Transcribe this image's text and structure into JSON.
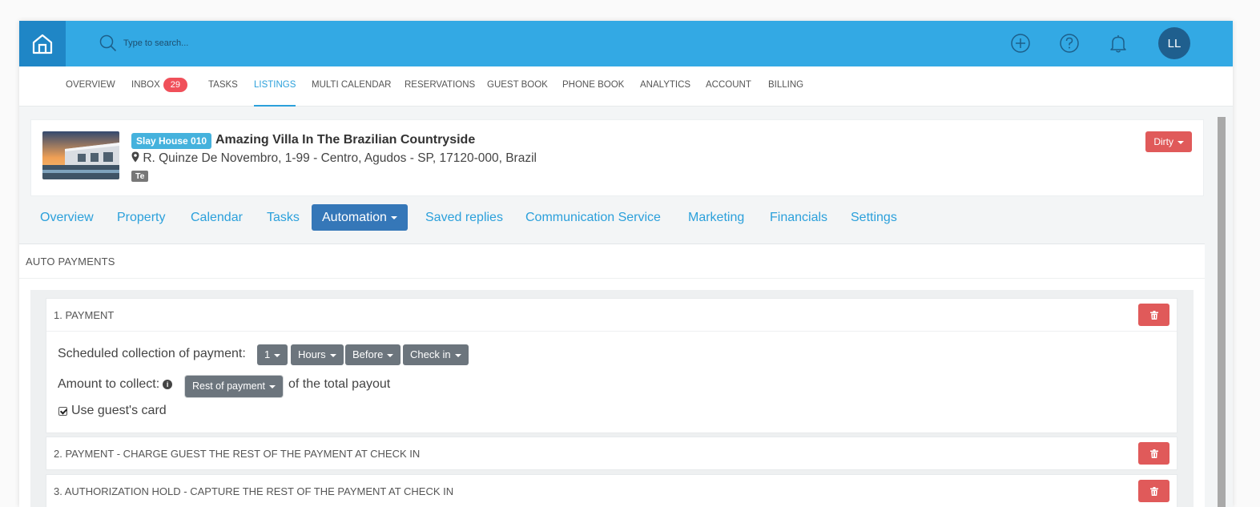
{
  "header": {
    "search_placeholder": "Type to search...",
    "avatar_initials": "LL",
    "icons": [
      "home-icon",
      "search-icon",
      "plus-circle-icon",
      "help-icon",
      "bell-icon"
    ]
  },
  "mainnav": {
    "items": [
      {
        "label": "OVERVIEW"
      },
      {
        "label": "INBOX",
        "badge": "29"
      },
      {
        "label": "TASKS"
      },
      {
        "label": "LISTINGS",
        "active": true
      },
      {
        "label": "MULTI CALENDAR"
      },
      {
        "label": "RESERVATIONS"
      },
      {
        "label": "GUEST BOOK"
      },
      {
        "label": "PHONE BOOK"
      },
      {
        "label": "ANALYTICS"
      },
      {
        "label": "ACCOUNT"
      },
      {
        "label": "BILLING"
      }
    ]
  },
  "listing": {
    "badge": "Slay House 010",
    "title": "Amazing Villa In The Brazilian Countryside",
    "address": "R. Quinze De Novembro, 1-99 - Centro, Agudos - SP, 17120-000, Brazil",
    "tag": "Te",
    "status": "Dirty"
  },
  "subnav": {
    "items": [
      {
        "label": "Overview"
      },
      {
        "label": "Property"
      },
      {
        "label": "Calendar"
      },
      {
        "label": "Tasks"
      },
      {
        "label": "Automation",
        "active": true
      },
      {
        "label": "Saved replies"
      },
      {
        "label": "Communication Service"
      },
      {
        "label": "Marketing"
      },
      {
        "label": "Financials"
      },
      {
        "label": "Settings"
      }
    ]
  },
  "auto_payments": {
    "title": "AUTO PAYMENTS",
    "payments": [
      {
        "title": "1. PAYMENT",
        "schedule_label": "Scheduled collection of payment:",
        "schedule": {
          "amount": "1",
          "unit": "Hours",
          "relation": "Before",
          "event": "Check in"
        },
        "amount_label": "Amount to collect:",
        "amount_value": "Rest of payment",
        "amount_suffix": "of the total payout",
        "use_card_label": "Use guest's card",
        "use_card_checked": true
      },
      {
        "title": "2. PAYMENT - CHARGE GUEST THE REST OF THE PAYMENT AT CHECK IN"
      },
      {
        "title": "3. AUTHORIZATION HOLD - CAPTURE THE REST OF THE PAYMENT AT CHECK IN"
      }
    ]
  },
  "colors": {
    "topbar": "#33a9e4",
    "accent": "#2ba0db",
    "danger": "#e05a5a",
    "active_tab": "#3577b8",
    "dropdown": "#6c757d"
  }
}
